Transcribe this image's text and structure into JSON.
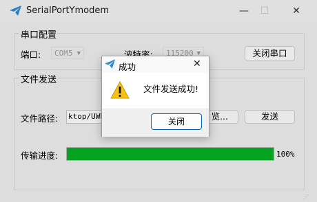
{
  "window": {
    "title": "SerialPortYmodem",
    "minimize_glyph": "—",
    "maximize_glyph": "☐",
    "close_glyph": "✕"
  },
  "serial_group": {
    "title": "串口配置",
    "port_label": "端口:",
    "port_value": "COM5",
    "baud_label": "波特率:",
    "baud_value": "115200",
    "close_port_button": "关闭串口"
  },
  "file_group": {
    "title": "文件发送",
    "path_label": "文件路径:",
    "path_value": "ktop/UWB",
    "browse_button": "览...",
    "send_button": "发送",
    "progress_label": "传输进度:",
    "progress_percent_text": "100%",
    "progress_value": 1.0
  },
  "dialog": {
    "title": "成功",
    "message": "文件发送成功!",
    "close_button": "关闭",
    "close_glyph": "✕"
  },
  "icons": {
    "app": "telegram-plane-icon",
    "warning": "warning-icon"
  },
  "colors": {
    "progress_fill": "#06b025",
    "app_icon": "#2f8bd6",
    "accent": "#0067c0"
  }
}
